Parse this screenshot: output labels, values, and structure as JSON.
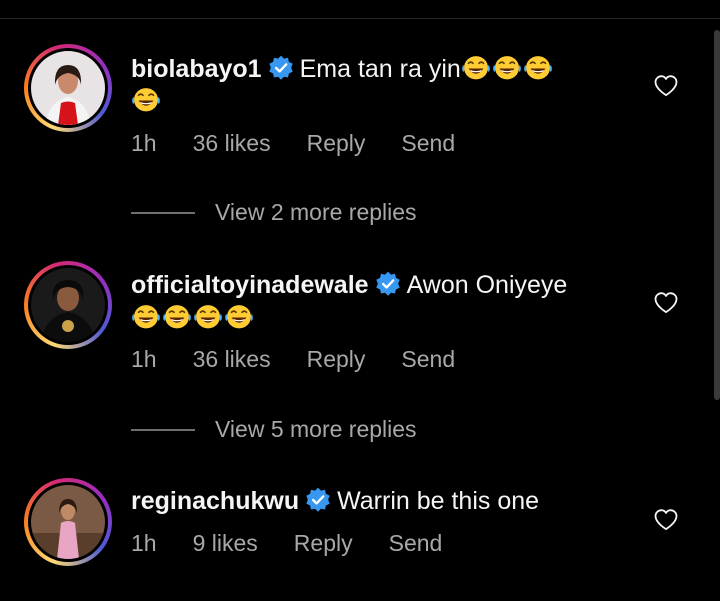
{
  "comments": [
    {
      "username": "biolabayo1",
      "text": "Ema tan ra yin",
      "emoji_inline": 3,
      "emoji_next_line": 1,
      "time": "1h",
      "likes": "36 likes",
      "reply": "Reply",
      "send": "Send",
      "more_replies": "View 2 more replies"
    },
    {
      "username": "officialtoyinadewale",
      "text": "Awon Oniyeye",
      "emoji_inline": 0,
      "emoji_next_line": 4,
      "time": "1h",
      "likes": "36 likes",
      "reply": "Reply",
      "send": "Send",
      "more_replies": "View 5 more replies"
    },
    {
      "username": "reginachukwu",
      "text": "Warrin be this one",
      "emoji_inline": 0,
      "emoji_next_line": 0,
      "time": "1h",
      "likes": "9 likes",
      "reply": "Reply",
      "send": "Send"
    }
  ],
  "icons": {
    "verified": "verified-badge-icon",
    "like": "heart-icon",
    "emoji": "face-with-tears-of-joy-emoji"
  },
  "colors": {
    "background": "#000000",
    "text_primary": "#f5f5f5",
    "text_secondary": "#a8a8a8",
    "verified_blue": "#3897f0",
    "emoji_yellow": "#ffcc33"
  }
}
